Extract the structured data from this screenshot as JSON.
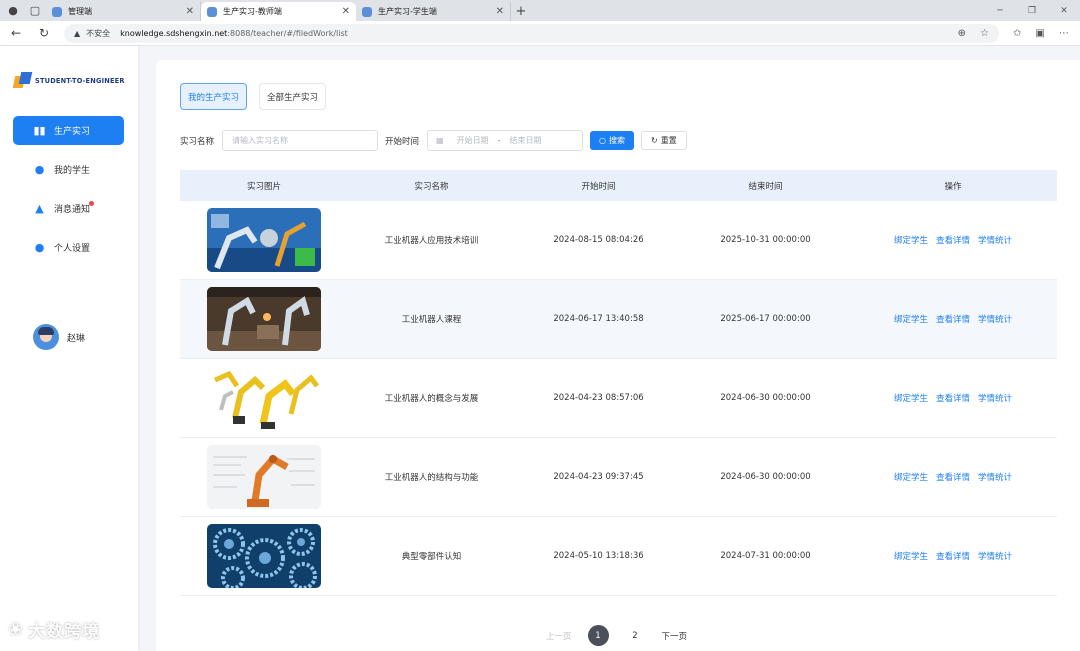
{
  "browser": {
    "tabs": [
      {
        "label": "管理端",
        "active": false
      },
      {
        "label": "生产实习-教师端",
        "active": true
      },
      {
        "label": "生产实习-学生端",
        "active": false
      }
    ],
    "address": {
      "security": "不安全",
      "host": "knowledge.sdshengxin.net",
      "path": ":8088/teacher/#/filedWork/list"
    }
  },
  "sidebar": {
    "logo": "STUDENT-TO-ENGINEER",
    "items": [
      {
        "label": "生产实习",
        "icon": "book-icon",
        "active": true
      },
      {
        "label": "我的学生",
        "icon": "students-icon",
        "active": false
      },
      {
        "label": "消息通知",
        "icon": "bell-icon",
        "active": false,
        "badge": true
      },
      {
        "label": "个人设置",
        "icon": "user-icon",
        "active": false
      }
    ],
    "user": {
      "name": "赵琳"
    }
  },
  "main": {
    "scope_tabs": [
      {
        "label": "我的生产实习",
        "active": true
      },
      {
        "label": "全部生产实习",
        "active": false
      }
    ],
    "filters": {
      "name_label": "实习名称",
      "name_placeholder": "请输入实习名称",
      "time_label": "开始时间",
      "start_placeholder": "开始日期",
      "range_sep": "-",
      "end_placeholder": "结束日期",
      "search_label": "搜索",
      "reset_label": "重置"
    },
    "table": {
      "headers": [
        "实习图片",
        "实习名称",
        "开始时间",
        "结束时间",
        "操作"
      ],
      "rows": [
        {
          "name": "工业机器人应用技术培训",
          "start": "2024-08-15 08:04:26",
          "end": "2025-10-31 00:00:00",
          "image": "robot-arms-blue-photo"
        },
        {
          "name": "工业机器人课程",
          "start": "2024-06-17 13:40:58",
          "end": "2025-06-17 00:00:00",
          "image": "factory-robots-photo"
        },
        {
          "name": "工业机器人的概念与发展",
          "start": "2024-04-23 08:57:06",
          "end": "2024-06-30 00:00:00",
          "image": "yellow-robot-arms-photo"
        },
        {
          "name": "工业机器人的结构与功能",
          "start": "2024-04-23 09:37:45",
          "end": "2024-06-30 00:00:00",
          "image": "robot-blueprint-photo"
        },
        {
          "name": "典型零部件认知",
          "start": "2024-05-10 13:18:36",
          "end": "2024-07-31 00:00:00",
          "image": "gears-photo"
        }
      ],
      "actions": [
        "绑定学生",
        "查看详情",
        "学情统计"
      ]
    },
    "pagination": {
      "prev": "上一页",
      "pages": [
        "1",
        "2"
      ],
      "current": "1",
      "next": "下一页"
    }
  },
  "watermark": "大数跨境",
  "colors": {
    "accent": "#1e7ff2",
    "header_bg": "#e8f1fb",
    "row_alt": "#f4f8fd",
    "badge": "#f04848"
  }
}
